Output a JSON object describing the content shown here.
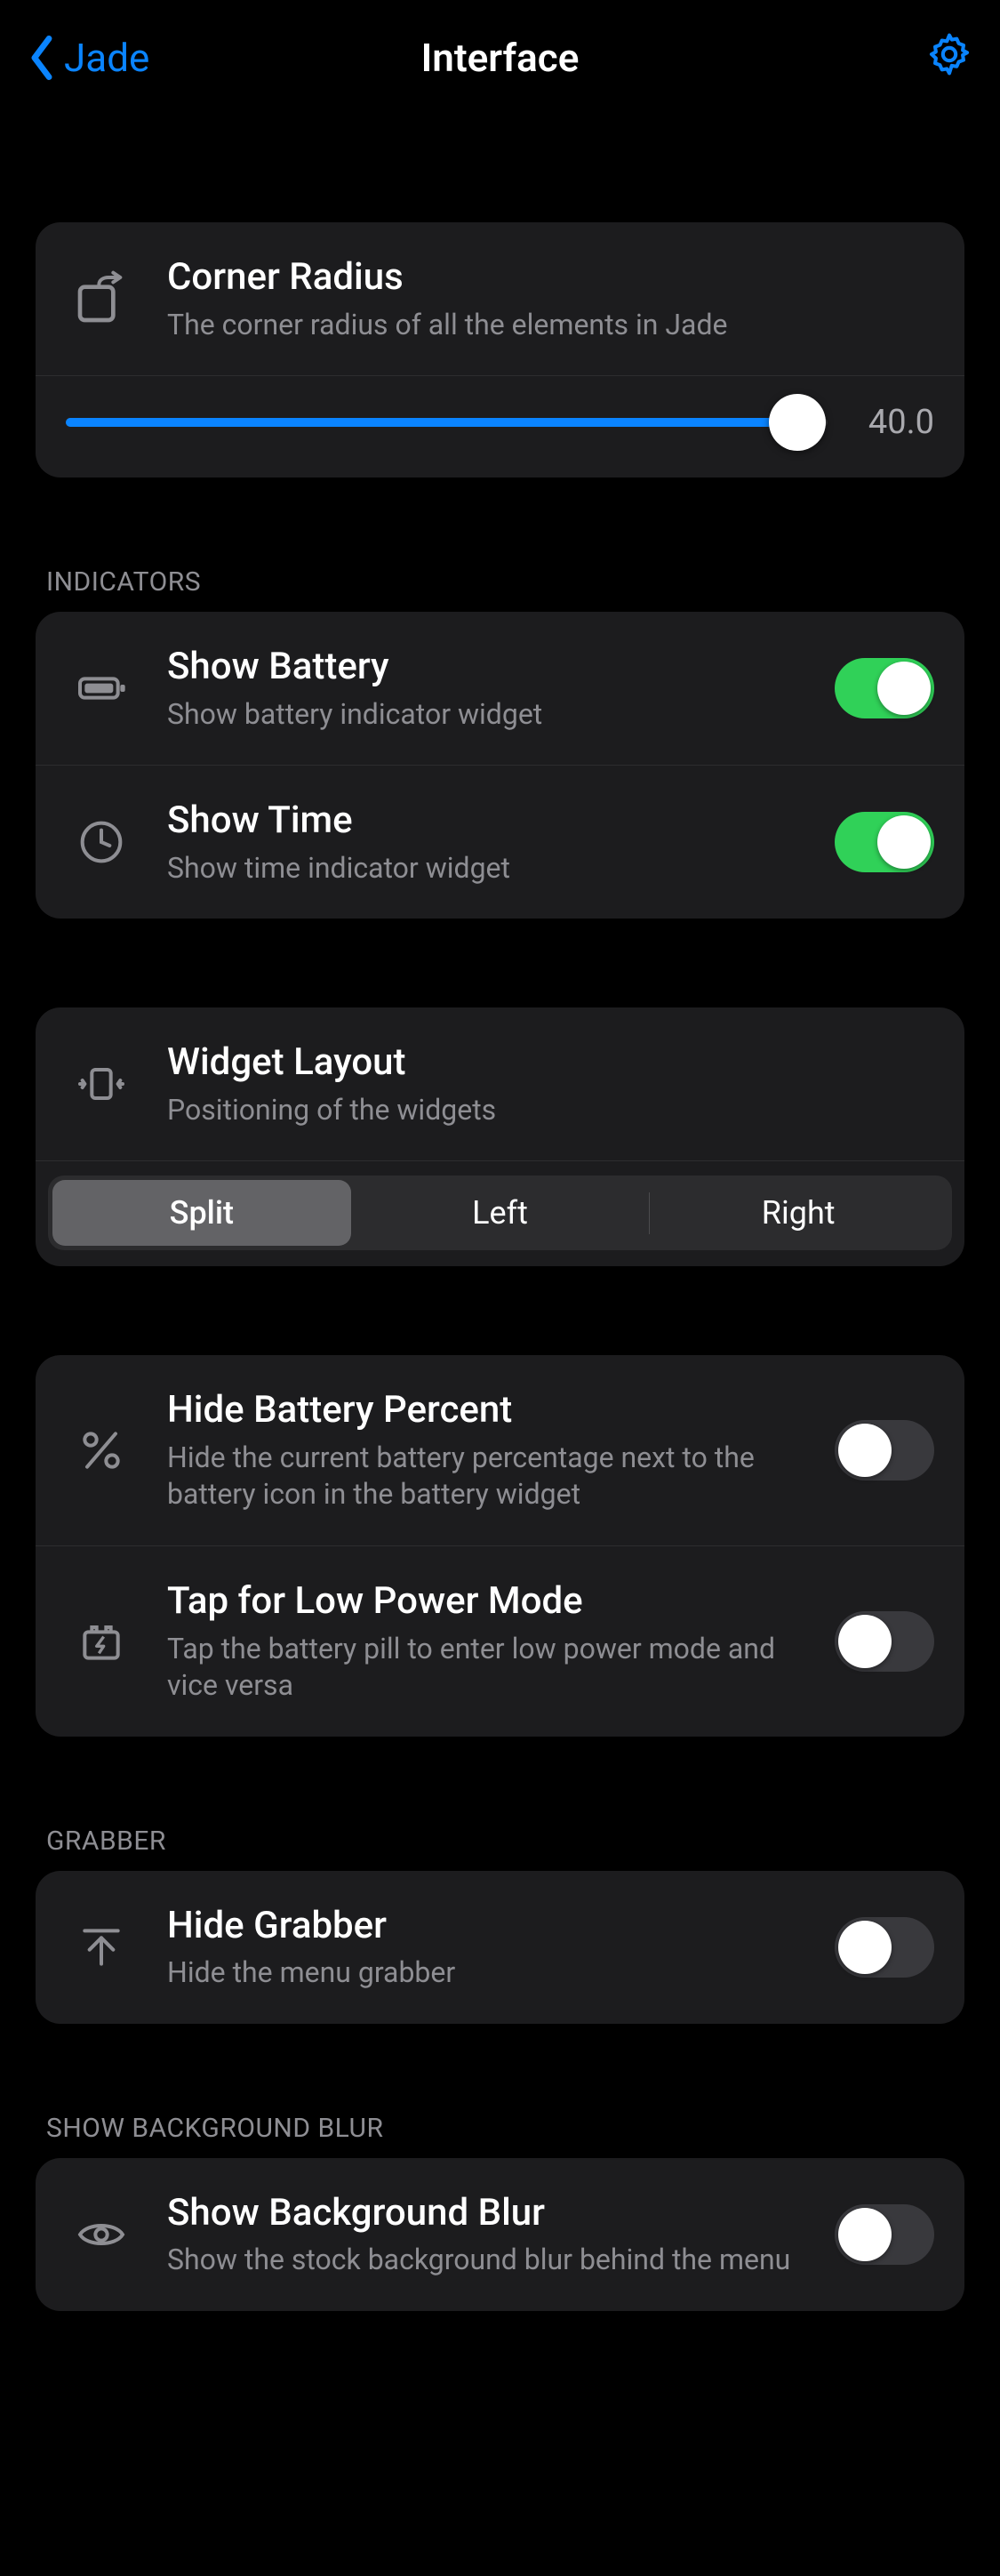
{
  "nav": {
    "back_label": "Jade",
    "title": "Interface"
  },
  "corner_radius": {
    "title": "Corner Radius",
    "subtitle": "The corner radius of all the elements in Jade",
    "value_display": "40.0",
    "percent": 96
  },
  "sections": {
    "indicators_header": "INDICATORS",
    "grabber_header": "GRABBER",
    "bg_blur_header": "SHOW BACKGROUND BLUR"
  },
  "indicators": {
    "show_battery": {
      "title": "Show Battery",
      "subtitle": "Show battery indicator widget",
      "on": true
    },
    "show_time": {
      "title": "Show Time",
      "subtitle": "Show time indicator widget",
      "on": true
    }
  },
  "widget_layout": {
    "title": "Widget Layout",
    "subtitle": "Positioning of the widgets",
    "options": [
      "Split",
      "Left",
      "Right"
    ],
    "selected": "Split"
  },
  "battery_opts": {
    "hide_percent": {
      "title": "Hide Battery Percent",
      "subtitle": "Hide the current battery percentage next to the battery icon in the battery widget",
      "on": false
    },
    "tap_lpm": {
      "title": "Tap for Low Power Mode",
      "subtitle": "Tap the battery pill to enter low power mode and vice versa",
      "on": false
    }
  },
  "grabber": {
    "hide": {
      "title": "Hide Grabber",
      "subtitle": "Hide the menu grabber",
      "on": false
    }
  },
  "bg_blur": {
    "show": {
      "title": "Show Background Blur",
      "subtitle": "Show the stock background blur behind the menu",
      "on": false
    }
  }
}
